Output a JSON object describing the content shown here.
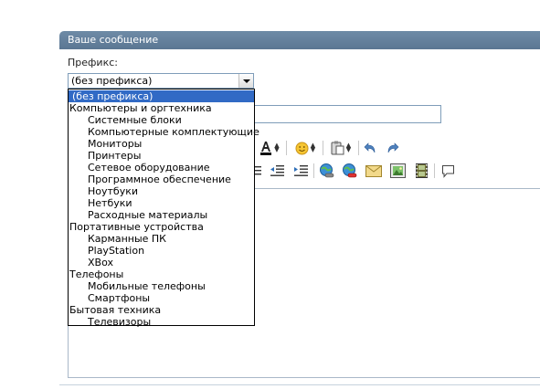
{
  "header": {
    "title": "Ваше сообщение"
  },
  "prefix": {
    "label": "Префикс:",
    "selected": "(без префикса)",
    "options": [
      {
        "label": "(без префикса)",
        "level": "selected"
      },
      {
        "label": "Компьютеры и оргтехника",
        "level": "group"
      },
      {
        "label": "Системные блоки",
        "level": "child"
      },
      {
        "label": "Компьютерные комплектующие",
        "level": "child"
      },
      {
        "label": "Мониторы",
        "level": "child"
      },
      {
        "label": "Принтеры",
        "level": "child"
      },
      {
        "label": "Сетевое оборудование",
        "level": "child"
      },
      {
        "label": "Программное обеспечение",
        "level": "child"
      },
      {
        "label": "Ноутбуки",
        "level": "child"
      },
      {
        "label": "Нетбуки",
        "level": "child"
      },
      {
        "label": "Расходные материалы",
        "level": "child"
      },
      {
        "label": "Портативные устройства",
        "level": "group"
      },
      {
        "label": "Карманные ПК",
        "level": "child"
      },
      {
        "label": "PlayStation",
        "level": "child"
      },
      {
        "label": "XBox",
        "level": "child"
      },
      {
        "label": "Телефоны",
        "level": "group"
      },
      {
        "label": "Мобильные телефоны",
        "level": "child"
      },
      {
        "label": "Смартфоны",
        "level": "child"
      },
      {
        "label": "Бытовая техника",
        "level": "group"
      },
      {
        "label": "Телевизоры",
        "level": "child"
      }
    ]
  },
  "title_input": {
    "value": ""
  },
  "toolbar": {
    "row1": [
      "font-color-icon",
      "smiley-icon",
      "paste-icon",
      "undo-icon",
      "redo-icon"
    ],
    "row2": [
      "list-icon",
      "outdent-icon",
      "indent-icon",
      "link-icon",
      "unlink-icon",
      "email-icon",
      "image-icon",
      "video-icon",
      "quote-icon"
    ]
  },
  "colors": {
    "header": "#5b7793",
    "selection": "#316ac5",
    "border": "#7f9db9"
  }
}
